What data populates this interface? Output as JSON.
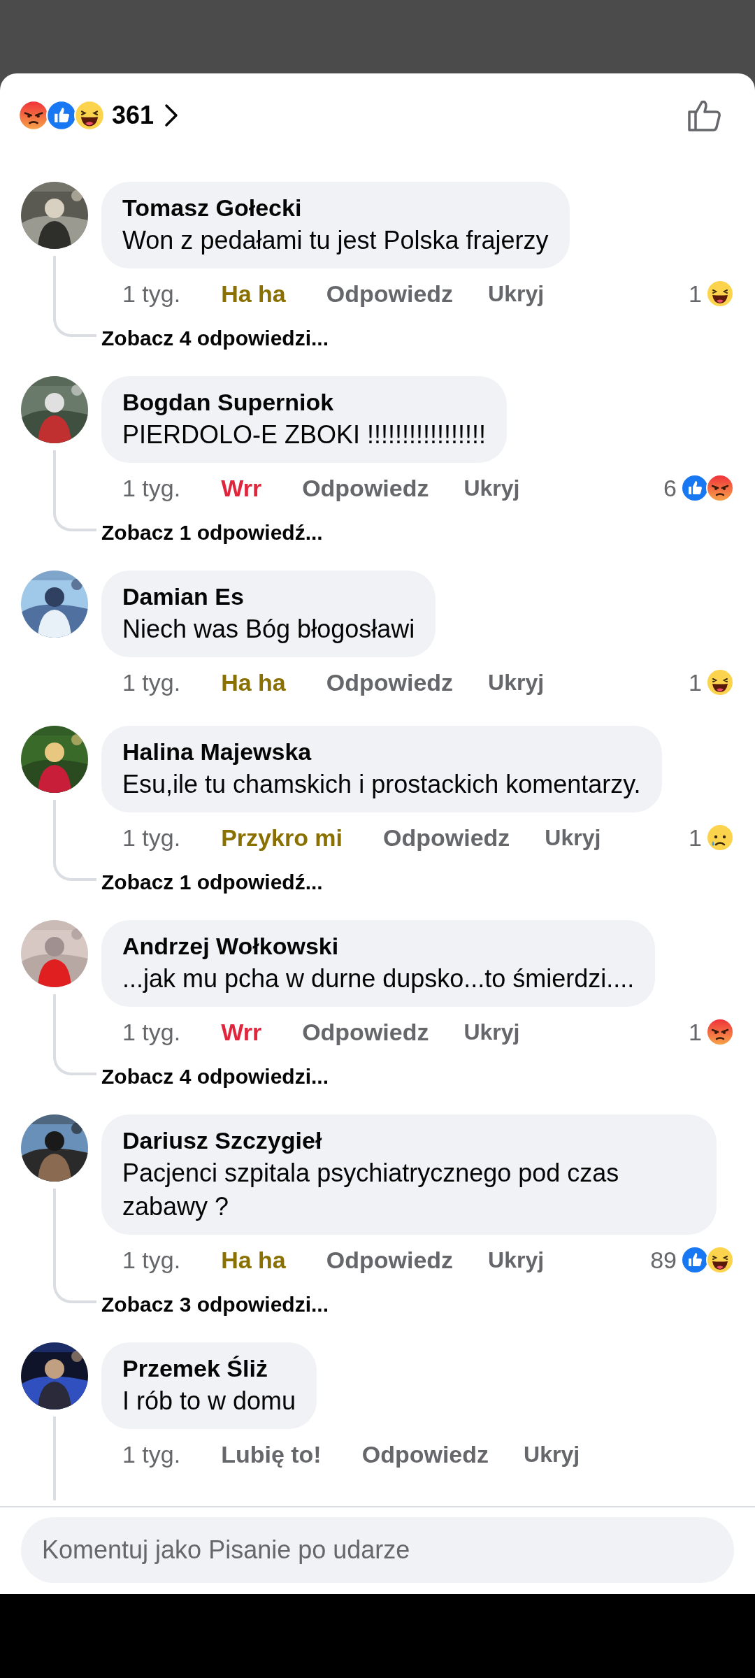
{
  "summary": {
    "reactions": [
      {
        "kind": "angry"
      },
      {
        "kind": "like"
      },
      {
        "kind": "haha"
      }
    ],
    "count": "361"
  },
  "comments": [
    {
      "author": "Tomasz Gołecki",
      "text": "Won z pedałami tu jest Polska frajerzy",
      "time": "1 tyg.",
      "my_reaction": {
        "kind": "haha",
        "label": "Ha ha"
      },
      "reply": "Odpowiedz",
      "hide": "Ukryj",
      "reaction_count": "1",
      "reactions": [
        {
          "kind": "haha"
        }
      ],
      "thread_line": true,
      "replies": "Zobacz 4 odpowiedzi..."
    },
    {
      "author": "Bogdan Superniok",
      "text": "PIERDOLO-E ZBOKI !!!!!!!!!!!!!!!!!",
      "time": "1 tyg.",
      "my_reaction": {
        "kind": "angry",
        "label": "Wrr"
      },
      "reply": "Odpowiedz",
      "hide": "Ukryj",
      "reaction_count": "6",
      "reactions": [
        {
          "kind": "like"
        },
        {
          "kind": "angry"
        }
      ],
      "thread_line": true,
      "replies": "Zobacz 1 odpowiedź..."
    },
    {
      "author": "Damian Es",
      "text": "Niech was Bóg błogosławi",
      "time": "1 tyg.",
      "my_reaction": {
        "kind": "haha",
        "label": "Ha ha"
      },
      "reply": "Odpowiedz",
      "hide": "Ukryj",
      "reaction_count": "1",
      "reactions": [
        {
          "kind": "haha"
        }
      ],
      "thread_line": false
    },
    {
      "author": "Halina Majewska",
      "text": "Esu,ile tu chamskich i prostackich komentarzy.",
      "time": "1 tyg.",
      "my_reaction": {
        "kind": "sad",
        "label": "Przykro mi"
      },
      "reply": "Odpowiedz",
      "hide": "Ukryj",
      "reaction_count": "1",
      "reactions": [
        {
          "kind": "sad"
        }
      ],
      "thread_line": true,
      "replies": "Zobacz 1 odpowiedź..."
    },
    {
      "author": "Andrzej Wołkowski",
      "text": "...jak mu pcha w durne dupsko...to śmierdzi....",
      "time": "1 tyg.",
      "my_reaction": {
        "kind": "angry",
        "label": "Wrr"
      },
      "reply": "Odpowiedz",
      "hide": "Ukryj",
      "reaction_count": "1",
      "reactions": [
        {
          "kind": "angry"
        }
      ],
      "thread_line": true,
      "replies": "Zobacz 4 odpowiedzi..."
    },
    {
      "author": "Dariusz Szczygieł",
      "text": "Pacjenci szpitala psychiatrycznego pod czas zabawy ?",
      "time": "1 tyg.",
      "my_reaction": {
        "kind": "haha",
        "label": "Ha ha"
      },
      "reply": "Odpowiedz",
      "hide": "Ukryj",
      "reaction_count": "89",
      "reactions": [
        {
          "kind": "like"
        },
        {
          "kind": "haha"
        }
      ],
      "thread_line": true,
      "replies": "Zobacz 3 odpowiedzi..."
    },
    {
      "author": "Przemek Śliż",
      "text": "I rób to w domu",
      "time": "1 tyg.",
      "my_reaction": {
        "kind": "none",
        "label": "Lubię to!"
      },
      "reply": "Odpowiedz",
      "hide": "Ukryj",
      "thread_line": true
    }
  ],
  "composer": {
    "placeholder": "Komentuj jako Pisanie po udarze"
  }
}
